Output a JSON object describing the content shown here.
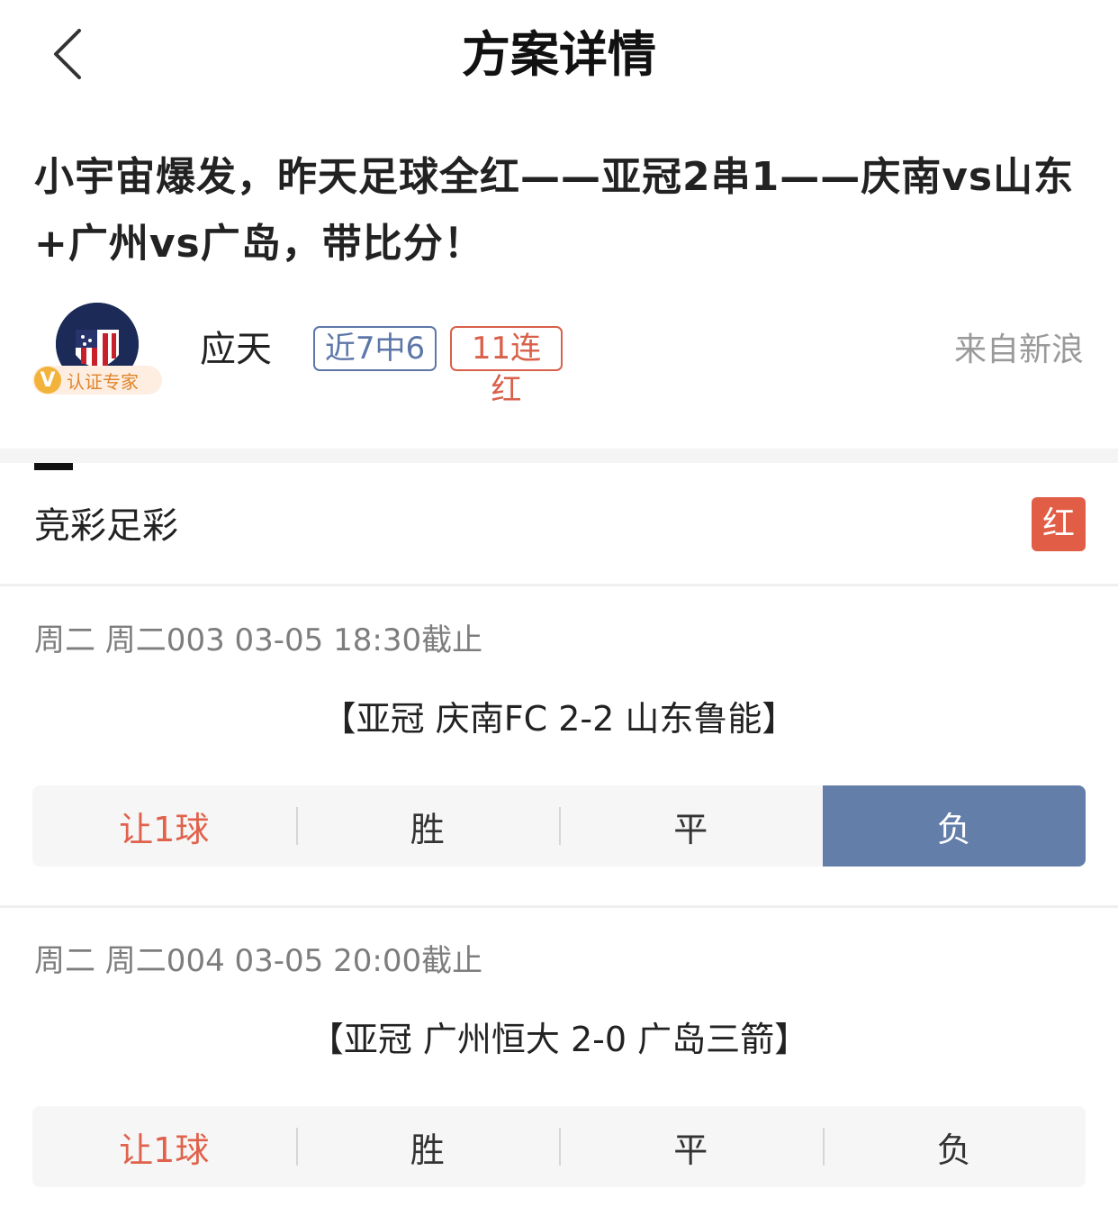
{
  "nav": {
    "title": "方案详情",
    "back_icon": "chevron-left-icon"
  },
  "headline": "小宇宙爆发，昨天足球全红——亚冠2串1——庆南vs山东+广州vs广岛，带比分！",
  "author": {
    "name": "应天",
    "cert_mark": "V",
    "cert_label": "认证专家",
    "badge_recent": "近7中6",
    "badge_streak": "11连红",
    "source": "来自新浪"
  },
  "section": {
    "title": "竞彩足彩",
    "result": "红"
  },
  "matches": [
    {
      "info": "周二 周二003 03-05 18:30截止",
      "teams": "【亚冠 庆南FC 2-2 山东鲁能】",
      "options": [
        "让1球",
        "胜",
        "平",
        "负"
      ],
      "selected": "负"
    },
    {
      "info": "周二 周二004 03-05 20:00截止",
      "teams": "【亚冠 广州恒大 2-0 广岛三箭】",
      "options": [
        "让1球",
        "胜",
        "平",
        "负"
      ],
      "selected": ""
    }
  ],
  "colors": {
    "accent_blue": "#627ea9",
    "accent_red": "#e25d45",
    "cert_gold": "#f3b23a"
  }
}
